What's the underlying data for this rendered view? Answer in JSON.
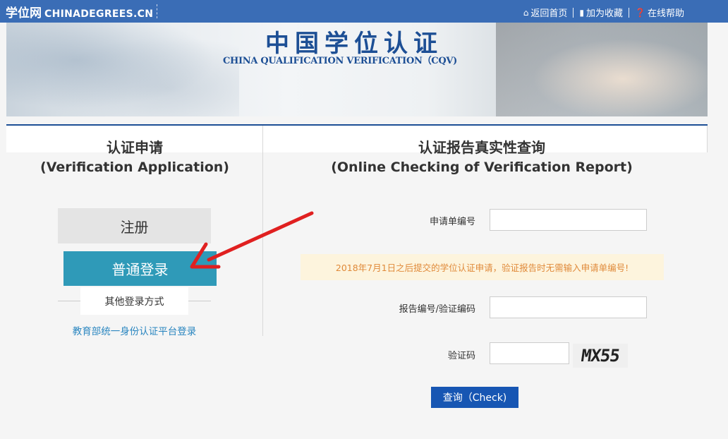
{
  "topbar": {
    "brand_cn": "学位网",
    "brand_en": "CHINADEGREES.CN",
    "links": [
      {
        "label": "返回首页",
        "icon": "home-icon"
      },
      {
        "label": "加为收藏",
        "icon": "bookmark-icon"
      },
      {
        "label": "在线帮助",
        "icon": "help-icon"
      }
    ]
  },
  "banner": {
    "title": "中国学位认证",
    "subtitle": "CHINA QUALIFICATION VERIFICATION（CQV)"
  },
  "left": {
    "heading_cn": "认证申请",
    "heading_en": "(Verification Application)",
    "register_label": "注册",
    "login_label": "普通登录",
    "other_login_label": "其他登录方式",
    "moe_login_link": "教育部统一身份认证平台登录"
  },
  "right": {
    "heading_cn": "认证报告真实性查询",
    "heading_en": "(Online Checking of Verification Report)",
    "application_no_label": "申请单编号",
    "notice": "2018年7月1日之后提交的学位认证申请，验证报告时无需输入申请单编号!",
    "report_no_label": "报告编号/验证编码",
    "captcha_label": "验证码",
    "captcha_text": "MX55",
    "check_button": "查询（Check)"
  },
  "colors": {
    "topbar": "#3a6db6",
    "login_button": "#2f9ab8",
    "check_button": "#1756b3",
    "notice_bg": "#fdf4dd",
    "notice_text": "#e08a3a",
    "annotation_arrow": "#e02020"
  }
}
